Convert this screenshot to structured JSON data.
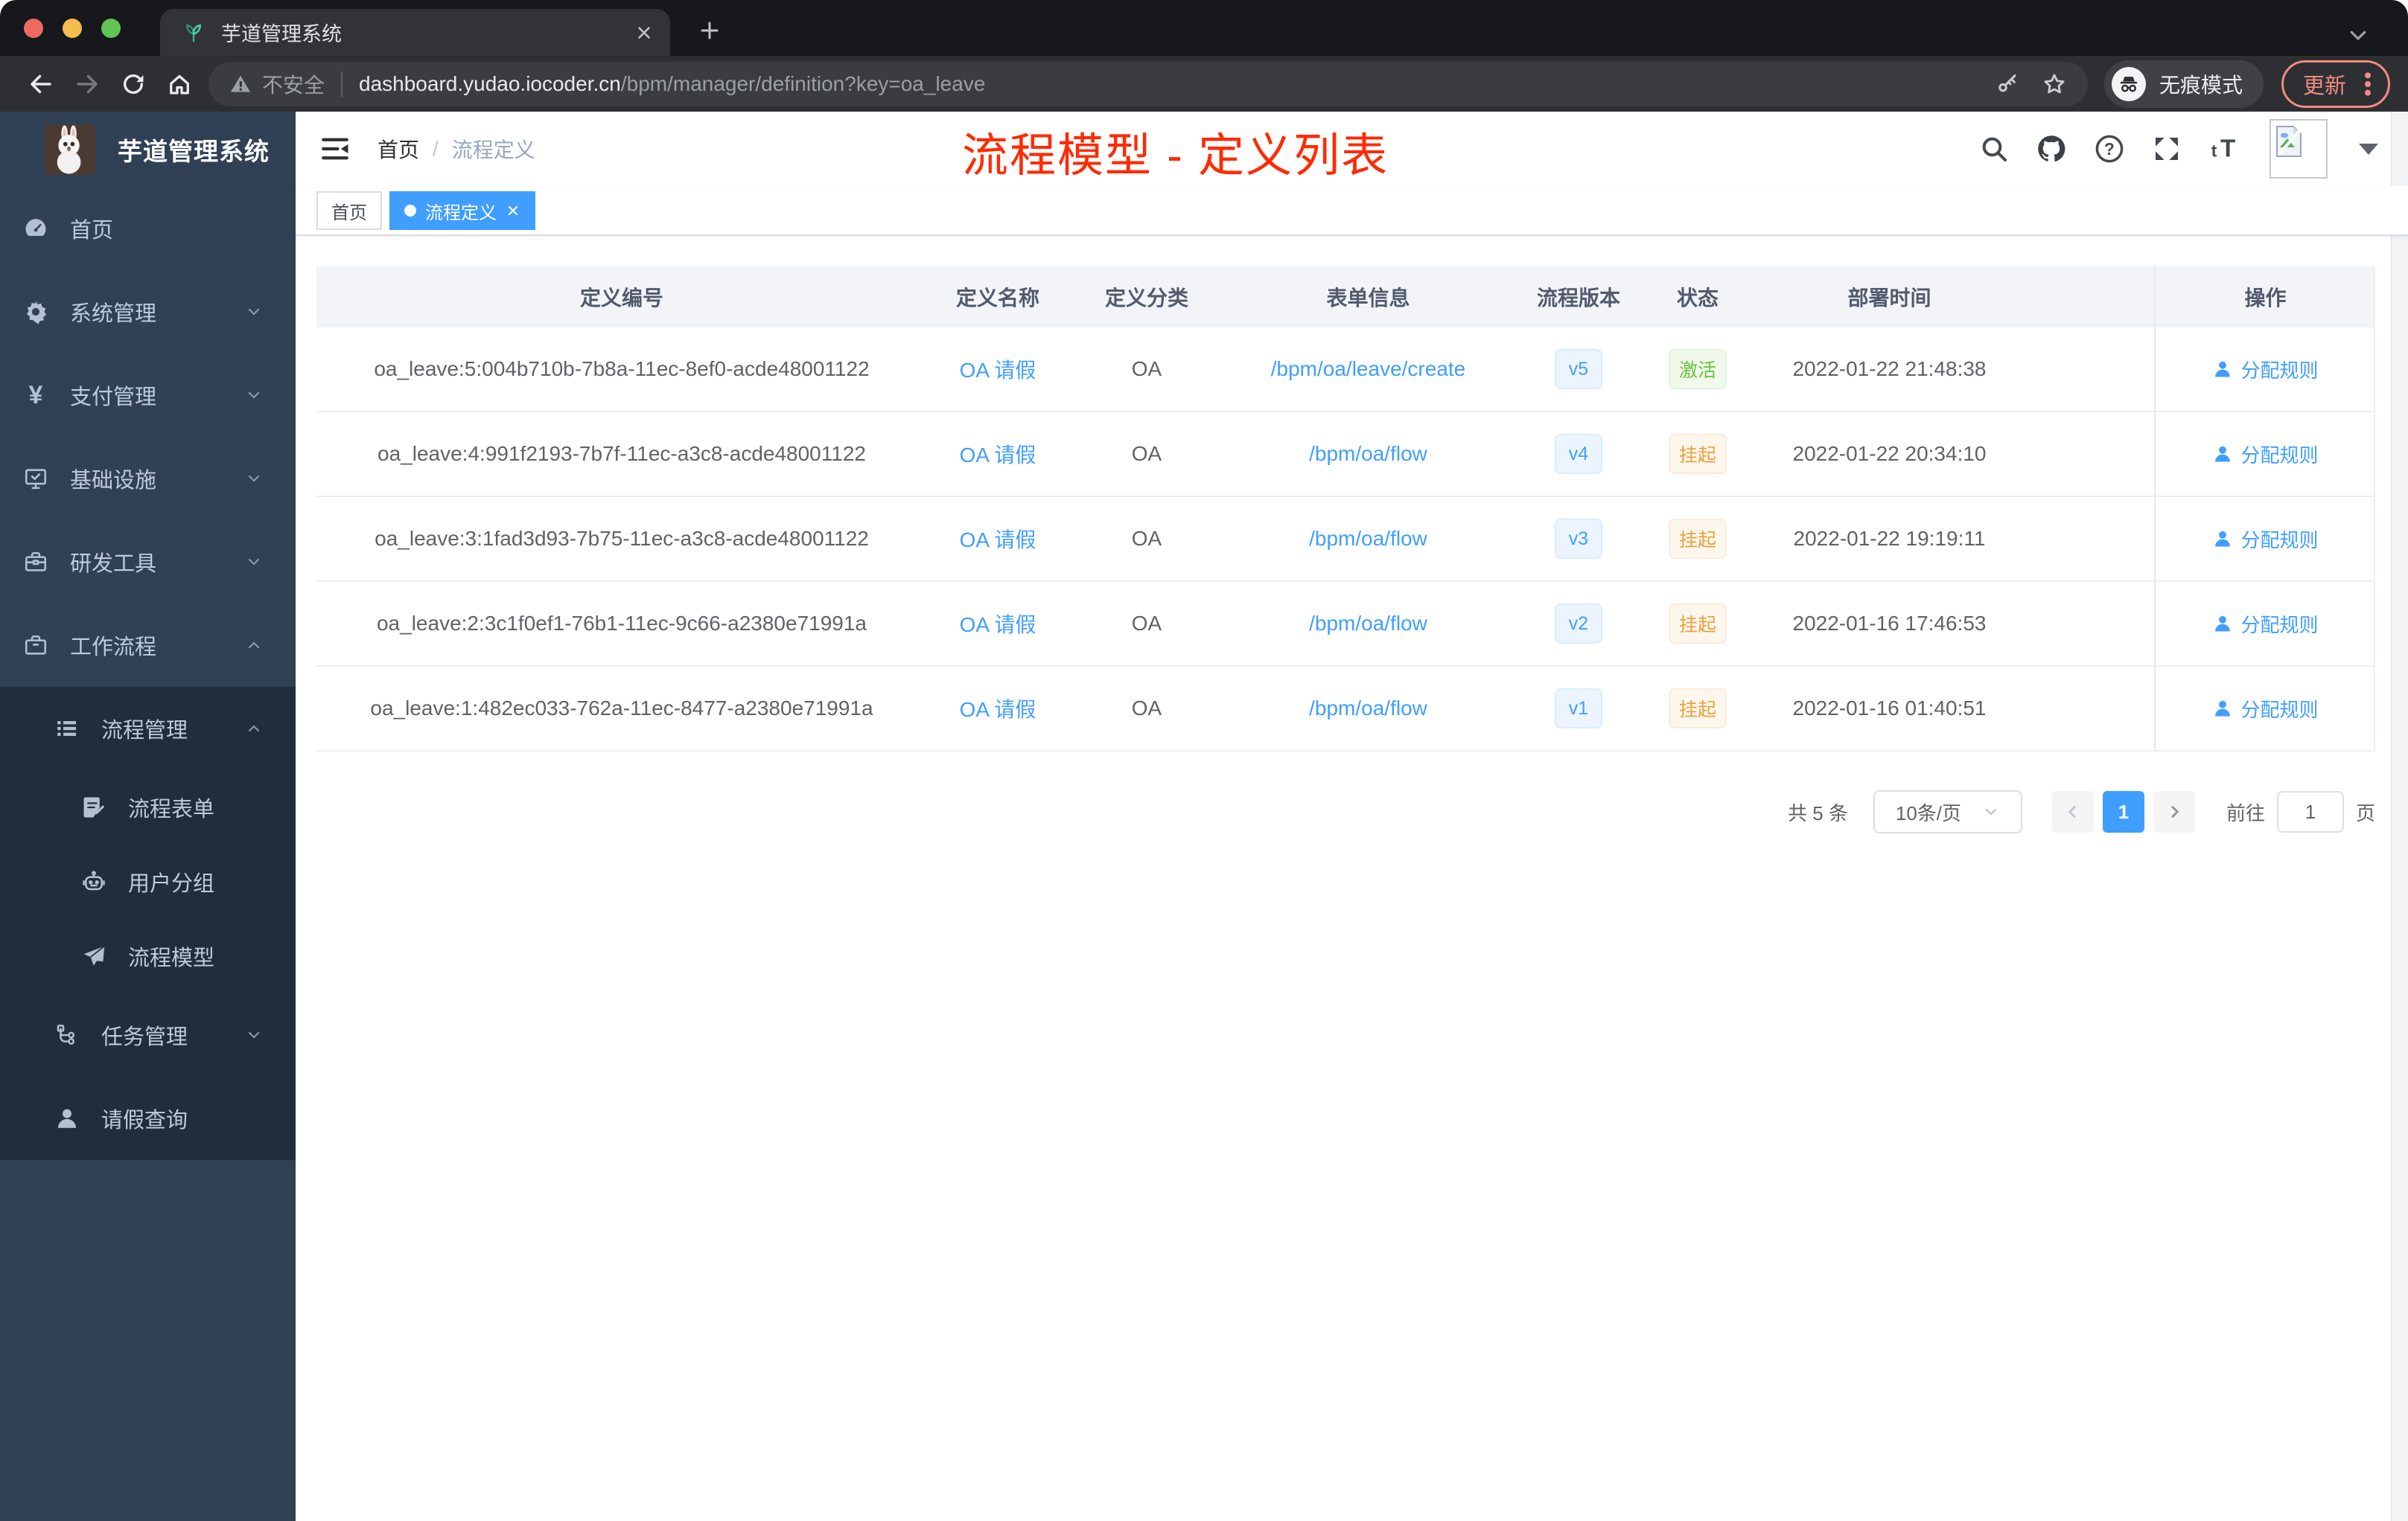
{
  "browser": {
    "tab_title": "芋道管理系统",
    "security_label": "不安全",
    "url_host": "dashboard.yudao.iocoder.cn",
    "url_path": "/bpm/manager/definition?key=oa_leave",
    "incognito_label": "无痕模式",
    "update_label": "更新",
    "traffic_colors": {
      "close": "#ee6a5f",
      "minimize": "#f5bd4f",
      "zoom": "#61c454"
    }
  },
  "sidebar": {
    "logo_title": "芋道管理系统",
    "items": [
      {
        "key": "home",
        "label": "首页",
        "icon": "dashboard-icon",
        "indent": 0,
        "chevron": null,
        "sub": false
      },
      {
        "key": "system",
        "label": "系统管理",
        "icon": "gear-icon",
        "indent": 0,
        "chevron": "down",
        "sub": false
      },
      {
        "key": "payment",
        "label": "支付管理",
        "icon": "yen-icon",
        "indent": 0,
        "chevron": "down",
        "sub": false
      },
      {
        "key": "infra",
        "label": "基础设施",
        "icon": "monitor-icon",
        "indent": 0,
        "chevron": "down",
        "sub": false
      },
      {
        "key": "devtools",
        "label": "研发工具",
        "icon": "toolbox-icon",
        "indent": 0,
        "chevron": "down",
        "sub": false
      },
      {
        "key": "workflow",
        "label": "工作流程",
        "icon": "briefcase-icon",
        "indent": 0,
        "chevron": "up",
        "sub": false
      },
      {
        "key": "process-mgmt",
        "label": "流程管理",
        "icon": "list-icon",
        "indent": 1,
        "chevron": "up",
        "sub": true
      },
      {
        "key": "process-form",
        "label": "流程表单",
        "icon": "form-icon",
        "indent": 2,
        "chevron": null,
        "sub": true
      },
      {
        "key": "user-group",
        "label": "用户分组",
        "icon": "robot-icon",
        "indent": 2,
        "chevron": null,
        "sub": true
      },
      {
        "key": "process-model",
        "label": "流程模型",
        "icon": "send-icon",
        "indent": 2,
        "chevron": null,
        "sub": true
      },
      {
        "key": "task-mgmt",
        "label": "任务管理",
        "icon": "tree-icon",
        "indent": 1,
        "chevron": "down",
        "sub": true
      },
      {
        "key": "leave-query",
        "label": "请假查询",
        "icon": "user-icon",
        "indent": 1,
        "chevron": null,
        "sub": true
      }
    ]
  },
  "navbar": {
    "breadcrumb": [
      "首页",
      "流程定义"
    ],
    "separator": "/"
  },
  "tags": [
    {
      "label": "首页",
      "active": false
    },
    {
      "label": "流程定义",
      "active": true
    }
  ],
  "annotation": {
    "text": "流程模型 - 定义列表",
    "color": "#ff2a00"
  },
  "table": {
    "columns": [
      {
        "label": "定义编号"
      },
      {
        "label": "定义名称"
      },
      {
        "label": "定义分类"
      },
      {
        "label": "表单信息"
      },
      {
        "label": "流程版本"
      },
      {
        "label": "状态"
      },
      {
        "label": "部署时间"
      },
      {
        "label": "操作"
      }
    ],
    "rows": [
      {
        "id": "oa_leave:5:004b710b-7b8a-11ec-8ef0-acde48001122",
        "name": "OA 请假",
        "category": "OA",
        "form": "/bpm/oa/leave/create",
        "version": "v5",
        "status": "激活",
        "status_type": "success",
        "time": "2022-01-22 21:48:38",
        "action": "分配规则"
      },
      {
        "id": "oa_leave:4:991f2193-7b7f-11ec-a3c8-acde48001122",
        "name": "OA 请假",
        "category": "OA",
        "form": "/bpm/oa/flow",
        "version": "v4",
        "status": "挂起",
        "status_type": "warning",
        "time": "2022-01-22 20:34:10",
        "action": "分配规则"
      },
      {
        "id": "oa_leave:3:1fad3d93-7b75-11ec-a3c8-acde48001122",
        "name": "OA 请假",
        "category": "OA",
        "form": "/bpm/oa/flow",
        "version": "v3",
        "status": "挂起",
        "status_type": "warning",
        "time": "2022-01-22 19:19:11",
        "action": "分配规则"
      },
      {
        "id": "oa_leave:2:3c1f0ef1-76b1-11ec-9c66-a2380e71991a",
        "name": "OA 请假",
        "category": "OA",
        "form": "/bpm/oa/flow",
        "version": "v2",
        "status": "挂起",
        "status_type": "warning",
        "time": "2022-01-16 17:46:53",
        "action": "分配规则"
      },
      {
        "id": "oa_leave:1:482ec033-762a-11ec-8477-a2380e71991a",
        "name": "OA 请假",
        "category": "OA",
        "form": "/bpm/oa/flow",
        "version": "v1",
        "status": "挂起",
        "status_type": "warning",
        "time": "2022-01-16 01:40:51",
        "action": "分配规则"
      }
    ]
  },
  "pagination": {
    "total": "共 5 条",
    "page_size": "10条/页",
    "current": "1",
    "goto_label": "前往",
    "goto_value": "1",
    "unit_label": "页"
  },
  "icons": {
    "help_glyph": "?",
    "font_size_glyph": "tT",
    "yen_glyph": "¥"
  }
}
